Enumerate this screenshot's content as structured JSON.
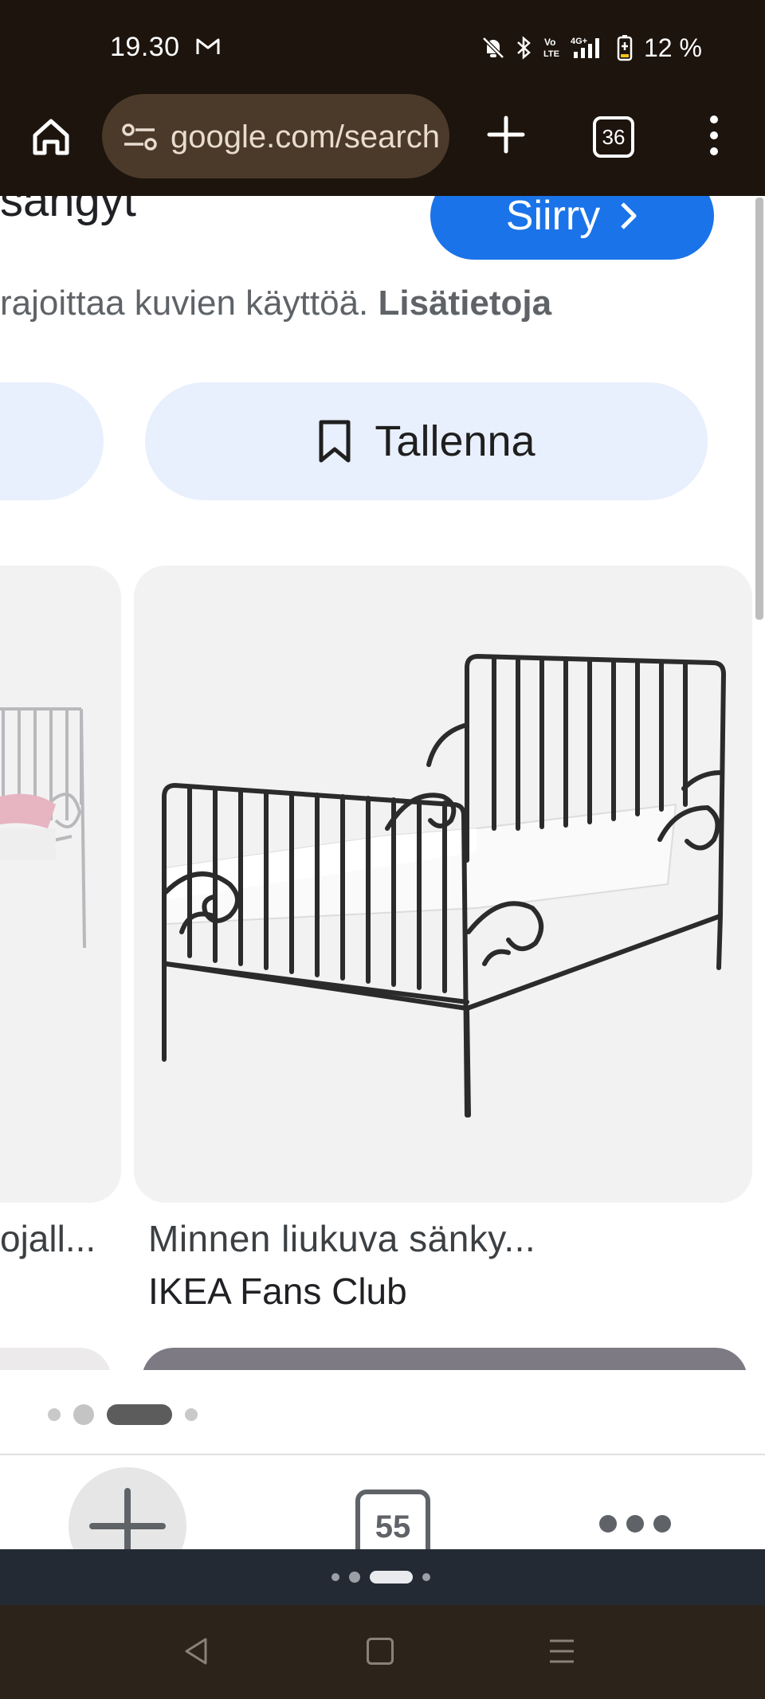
{
  "status_bar": {
    "time": "19.30",
    "mail_icon": "gmail-icon",
    "battery": "12 %",
    "network_label": "4G+",
    "volte_label": "Vo LTE"
  },
  "browser": {
    "url": "google.com/search",
    "tab_count": "36"
  },
  "page": {
    "heading_fragment": "sängyt",
    "go_button": "Siirry",
    "notice_text": "rajoittaa kuvien käyttöä.",
    "notice_link": "Lisätietoja",
    "save_button": "Tallenna",
    "left_card_caption": "ojall...",
    "main_card": {
      "title": "Minnen liukuva sänky...",
      "source": "IKEA Fans Club"
    }
  },
  "bottom_sheet": {
    "tabs_count": "55"
  },
  "colors": {
    "status_bg": "#1c140d",
    "url_bar_bg": "#4b3a2a",
    "accent_blue": "#1a73e8",
    "pill_bg": "#e8effd",
    "card_bg": "#f2f2f3"
  }
}
